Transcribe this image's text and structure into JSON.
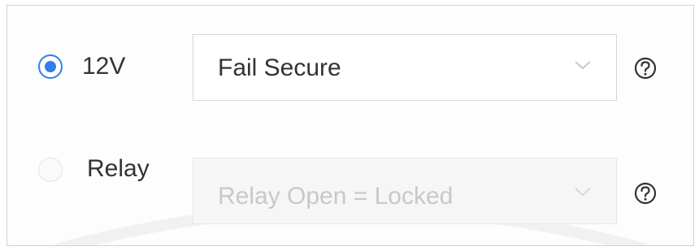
{
  "lock_type": {
    "options": [
      {
        "label": "12V",
        "selected": true,
        "select_value": "Fail Secure",
        "select_enabled": true,
        "help_icon": "question-circle-icon"
      },
      {
        "label": "Relay",
        "selected": false,
        "select_value": "Relay Open = Locked",
        "select_enabled": false,
        "help_icon": "question-circle-icon"
      }
    ]
  },
  "colors": {
    "accent": "#2f80ed",
    "text": "#333333",
    "disabled_text": "#c8c8c8",
    "border": "#d6d6d6"
  },
  "icons": {
    "chevron": "chevron-down-icon",
    "help": "question-circle-icon"
  }
}
